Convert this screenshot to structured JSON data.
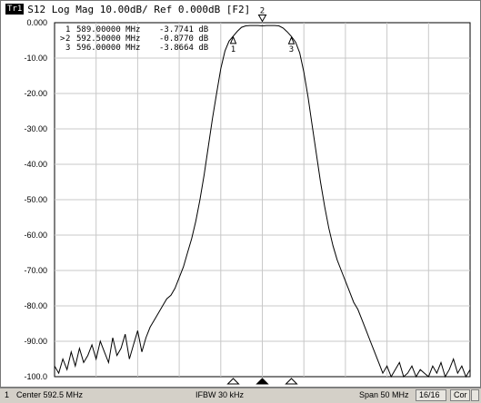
{
  "header": {
    "trace_badge": "Tr1",
    "text": "S12 Log Mag 10.00dB/ Ref 0.000dB [F2]"
  },
  "markers": [
    {
      "num": "1",
      "active": "",
      "freq": "589.00000 MHz",
      "value": "-3.7741 dB",
      "label": "1"
    },
    {
      "num": "2",
      "active": ">",
      "freq": "592.50000 MHz",
      "value": "-0.8770 dB",
      "label": "2"
    },
    {
      "num": "3",
      "active": "",
      "freq": "596.00000 MHz",
      "value": "-3.8664 dB",
      "label": "3"
    }
  ],
  "status": {
    "channel": "1",
    "center": "Center 592.5 MHz",
    "ifbw": "IFBW 30 kHz",
    "span": "Span 50 MHz",
    "points": "16/16",
    "correction": "Cor"
  },
  "chart_data": {
    "type": "line",
    "title": "S12 Log Mag 10.00dB/ Ref 0.000dB [F2]",
    "xlabel": "",
    "ylabel": "",
    "xlim": [
      567.5,
      617.5
    ],
    "ylim": [
      -100,
      0
    ],
    "grid": true,
    "y_ticks": [
      "0.000",
      "-10.00",
      "-20.00",
      "-30.00",
      "-40.00",
      "-50.00",
      "-60.00",
      "-70.00",
      "-80.00",
      "-90.00",
      "-100.0"
    ],
    "series": [
      {
        "name": "S12",
        "x": [
          567.5,
          568,
          568.5,
          569,
          569.5,
          570,
          570.5,
          571,
          571.5,
          572,
          572.5,
          573,
          573.5,
          574,
          574.5,
          575,
          575.5,
          576,
          576.5,
          577,
          577.5,
          578,
          578.5,
          579,
          579.5,
          580,
          580.5,
          581,
          581.5,
          582,
          582.5,
          583,
          583.5,
          584,
          584.5,
          585,
          585.5,
          586,
          586.5,
          587,
          587.5,
          588,
          588.5,
          589,
          589.5,
          590,
          590.5,
          591,
          591.5,
          592,
          592.5,
          593,
          593.5,
          594,
          594.5,
          595,
          595.5,
          596,
          596.5,
          597,
          597.5,
          598,
          598.5,
          599,
          599.5,
          600,
          600.5,
          601,
          601.5,
          602,
          602.5,
          603,
          603.5,
          604,
          604.5,
          605,
          605.5,
          606,
          606.5,
          607,
          607.5,
          608,
          608.5,
          609,
          609.5,
          610,
          610.5,
          611,
          611.5,
          612,
          612.5,
          613,
          613.5,
          614,
          614.5,
          615,
          615.5,
          616,
          616.5,
          617,
          617.5
        ],
        "values": [
          -97,
          -99,
          -95,
          -98,
          -93,
          -97,
          -92,
          -96,
          -94,
          -91,
          -95,
          -90,
          -93,
          -96,
          -89,
          -94,
          -92,
          -88,
          -95,
          -91,
          -87,
          -93,
          -89,
          -86,
          -84,
          -82,
          -80,
          -78,
          -77,
          -75,
          -72,
          -69,
          -65,
          -61,
          -56,
          -50,
          -43,
          -35,
          -27,
          -20,
          -13,
          -8,
          -5.2,
          -3.8,
          -2.4,
          -1.3,
          -0.9,
          -0.8,
          -0.8,
          -0.8,
          -0.9,
          -0.8,
          -0.8,
          -0.8,
          -0.9,
          -1.5,
          -2.6,
          -3.9,
          -5.5,
          -8.5,
          -14,
          -21,
          -29,
          -37,
          -45,
          -52,
          -58,
          -63,
          -67,
          -70,
          -73,
          -76,
          -79,
          -81,
          -84,
          -87,
          -90,
          -93,
          -96,
          -99,
          -97,
          -100,
          -98,
          -96,
          -100,
          -99,
          -97,
          -100,
          -98,
          -99,
          -100,
          -97,
          -99,
          -96,
          -100,
          -98,
          -95,
          -99,
          -97,
          -100,
          -98
        ]
      }
    ]
  }
}
